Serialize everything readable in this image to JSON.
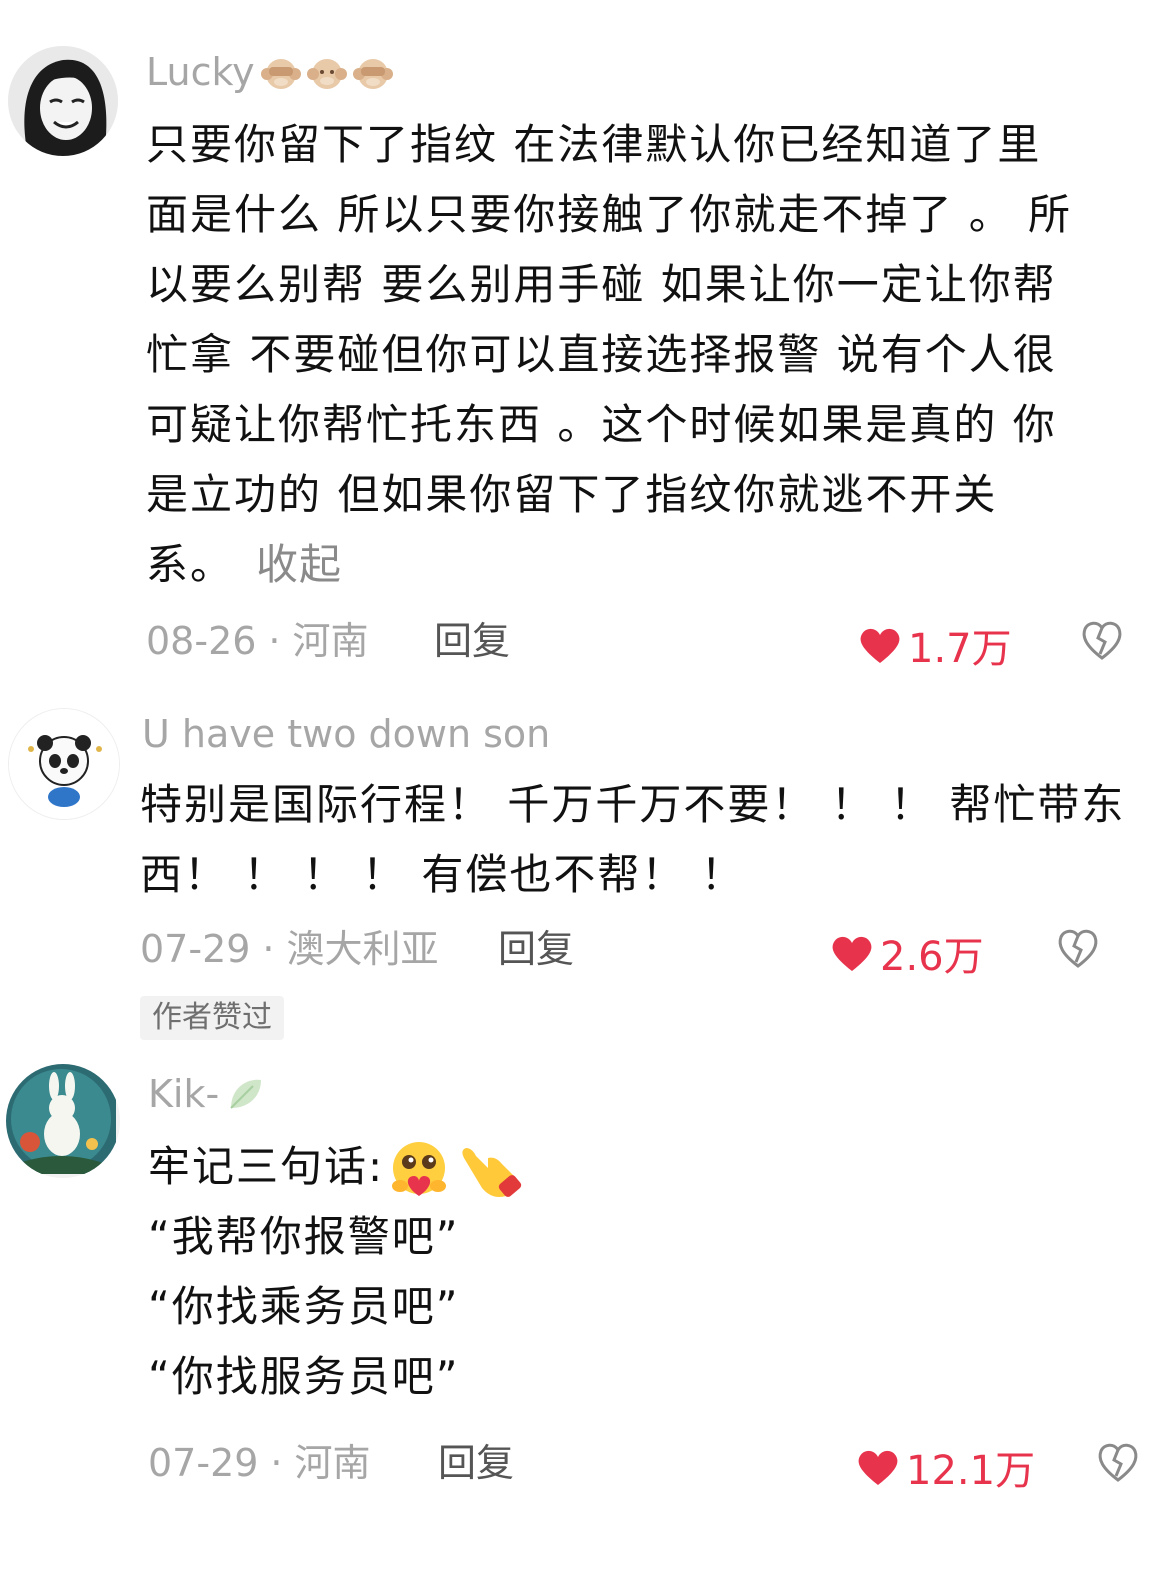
{
  "comments": [
    {
      "username": "Lucky",
      "username_decoration": [
        "see-no-evil-monkey-icon",
        "monkey-face-icon",
        "see-no-evil-monkey-icon"
      ],
      "lines": [
        "只要你留下了指纹 在法律默认你已经知道了里",
        "面是什么 所以只要你接触了你就走不掉了 。 所",
        "以要么别帮 要么别用手碰 如果让你一定让你帮",
        "忙拿 不要碰但你可以直接选择报警 说有个人很",
        "可疑让你帮忙托东西 。这个时候如果是真的 你",
        "是立功的 但如果你留下了指纹你就逃不开关",
        "系。"
      ],
      "collapse_label": "收起",
      "date": "08-26",
      "location": "河南",
      "reply_label": "回复",
      "likes": "1.7万"
    },
    {
      "username": "U have two down son",
      "lines": [
        "特别是国际行程！ 千万千万不要！ ！ ！ 帮忙带东",
        "西！ ！ ！ ！ 有偿也不帮！ ！"
      ],
      "date": "07-29",
      "location": "澳大利亚",
      "reply_label": "回复",
      "likes": "2.6万",
      "badge": "作者赞过"
    },
    {
      "username": "Kik-",
      "username_decoration": [
        "leaf-icon"
      ],
      "lines": [
        "牢记三句话:",
        "“我帮你报警吧”",
        "“你找乘务员吧”",
        "“你找服务员吧”"
      ],
      "line_emojis": [
        "heart-hands-face-icon",
        "pointing-finger-icon"
      ],
      "date": "07-29",
      "location": "河南",
      "reply_label": "回复",
      "likes": "12.1万"
    }
  ],
  "colors": {
    "like": "#e8334d",
    "meta": "#a6a6a6",
    "text": "#111111",
    "badge_bg": "#f2f2f2"
  },
  "separator": "·"
}
